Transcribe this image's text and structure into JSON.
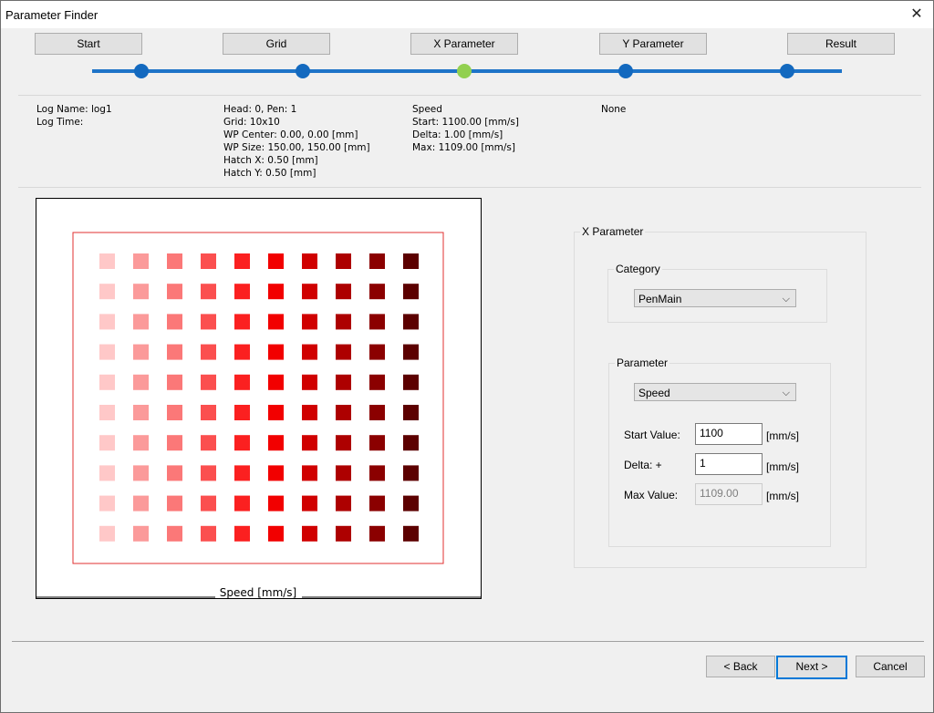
{
  "window": {
    "title": "Parameter Finder"
  },
  "steps": [
    {
      "label": "Start"
    },
    {
      "label": "Grid"
    },
    {
      "label": "X Parameter"
    },
    {
      "label": "Y Parameter"
    },
    {
      "label": "Result"
    }
  ],
  "progress": {
    "active_step": 2,
    "total_steps": 5
  },
  "info": {
    "col1": "Log Name: log1\nLog Time:",
    "col2": "Head: 0, Pen: 1\nGrid: 10x10\nWP Center: 0.00, 0.00 [mm]\nWP Size: 150.00, 150.00 [mm]\nHatch X: 0.50 [mm]\nHatch Y: 0.50 [mm]",
    "col3": "Speed\nStart: 1100.00 [mm/s]\nDelta: 1.00 [mm/s]\nMax: 1109.00 [mm/s]",
    "col4": "None"
  },
  "preview": {
    "axis_label": "Speed [mm/s]",
    "grid_rows": 10,
    "grid_cols": 10,
    "column_colors": [
      "#ffc8c8",
      "#fb9a9a",
      "#fb7878",
      "#fb4f4f",
      "#fb2020",
      "#f20000",
      "#d00000",
      "#ad0000",
      "#8b0000",
      "#5c0000"
    ]
  },
  "x_parameter": {
    "group_title": "X Parameter",
    "category": {
      "title": "Category",
      "selected": "PenMain"
    },
    "parameter": {
      "title": "Parameter",
      "selected": "Speed",
      "start_label": "Start Value:",
      "start_value": "1100",
      "start_unit": "[mm/s]",
      "delta_label": "Delta: +",
      "delta_value": "1",
      "delta_unit": "[mm/s]",
      "max_label": "Max Value:",
      "max_value": "1109.00",
      "max_unit": "[mm/s]"
    }
  },
  "footer": {
    "back": "< Back",
    "next": "Next >",
    "cancel": "Cancel"
  }
}
